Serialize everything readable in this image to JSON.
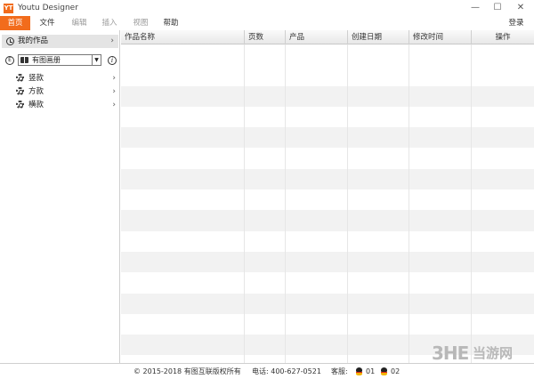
{
  "window": {
    "logo_text": "YT",
    "title": "Youtu Designer",
    "minimize": "—",
    "maximize": "☐",
    "close": "✕"
  },
  "menu": {
    "items": [
      {
        "label": "首页"
      },
      {
        "label": "文件"
      },
      {
        "label": "编辑"
      },
      {
        "label": "插入"
      },
      {
        "label": "视图"
      },
      {
        "label": "帮助"
      }
    ],
    "login": "登录"
  },
  "sidebar": {
    "my_works": "我的作品",
    "chevron": "›",
    "e_icon": "E",
    "album_select": "有图画册",
    "select_arrow": "▼",
    "info": "i",
    "categories": [
      {
        "label": "竖款"
      },
      {
        "label": "方款"
      },
      {
        "label": "横款"
      }
    ]
  },
  "table": {
    "columns": [
      "作品名称",
      "页数",
      "产品",
      "创建日期",
      "修改时间",
      "操作"
    ]
  },
  "status": {
    "copyright": "© 2015-2018 有图互联版权所有",
    "phone": "电话: 400-627-0521",
    "service_label": "客服:",
    "qq1": "01",
    "qq2": "02"
  },
  "watermark": {
    "latin": "3HE",
    "cn": "当游网"
  },
  "colors": {
    "accent": "#f26c1c",
    "row_alt": "#f2f2f2",
    "selected_sidebar": "#e4e4e4"
  }
}
